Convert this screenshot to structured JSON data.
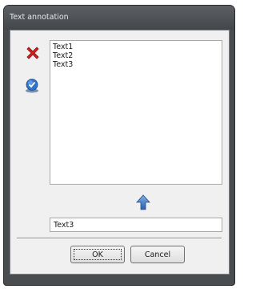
{
  "window": {
    "title": "Text annotation"
  },
  "toolbar": {
    "delete_icon": "red-x-icon",
    "confirm_icon": "blue-check-icon",
    "move_up_icon": "blue-up-arrow-icon"
  },
  "list": {
    "items": [
      "Text1",
      "Text2",
      "Text3"
    ]
  },
  "editor": {
    "value": "Text3"
  },
  "buttons": {
    "ok_label": "OK",
    "cancel_label": "Cancel"
  },
  "colors": {
    "titlebar": "#4a4d50",
    "delete_icon": "#d42020",
    "confirm_icon": "#2f74c8"
  }
}
